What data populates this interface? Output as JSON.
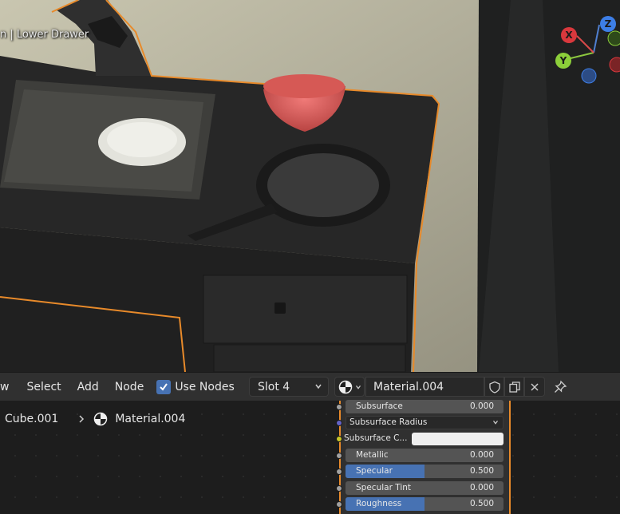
{
  "viewport": {
    "object_label": "n | Lower Drawer",
    "gizmo": {
      "x_label": "X",
      "y_label": "Y",
      "z_label": "Z"
    }
  },
  "header": {
    "menu_view": "w",
    "menu_select": "Select",
    "menu_add": "Add",
    "menu_node": "Node",
    "use_nodes_label": "Use Nodes",
    "use_nodes_checked": true,
    "slot": "Slot 4",
    "material_name": "Material.004"
  },
  "breadcrumb": {
    "object": "Cube.001",
    "material": "Material.004"
  },
  "node": {
    "subsurface": {
      "label": "Subsurface",
      "value": "0.000",
      "fraction": 0
    },
    "subsurface_radius": {
      "label": "Subsurface Radius"
    },
    "subsurface_color": {
      "label": "Subsurface C...",
      "color": "#efefef"
    },
    "metallic": {
      "label": "Metallic",
      "value": "0.000",
      "fraction": 0
    },
    "specular": {
      "label": "Specular",
      "value": "0.500",
      "fraction": 0.5
    },
    "specular_tint": {
      "label": "Specular Tint",
      "value": "0.000",
      "fraction": 0
    },
    "roughness": {
      "label": "Roughness",
      "value": "0.500",
      "fraction": 0.5
    }
  },
  "colors": {
    "accent": "#4772b3",
    "selection_outline": "#e88a2a",
    "header_bg": "#303030"
  },
  "icons": [
    "material-ball-icon",
    "chevron-down-icon",
    "shield-icon",
    "duplicate-icon",
    "close-icon",
    "pin-icon",
    "chevron-right-icon",
    "checkmark-icon"
  ]
}
